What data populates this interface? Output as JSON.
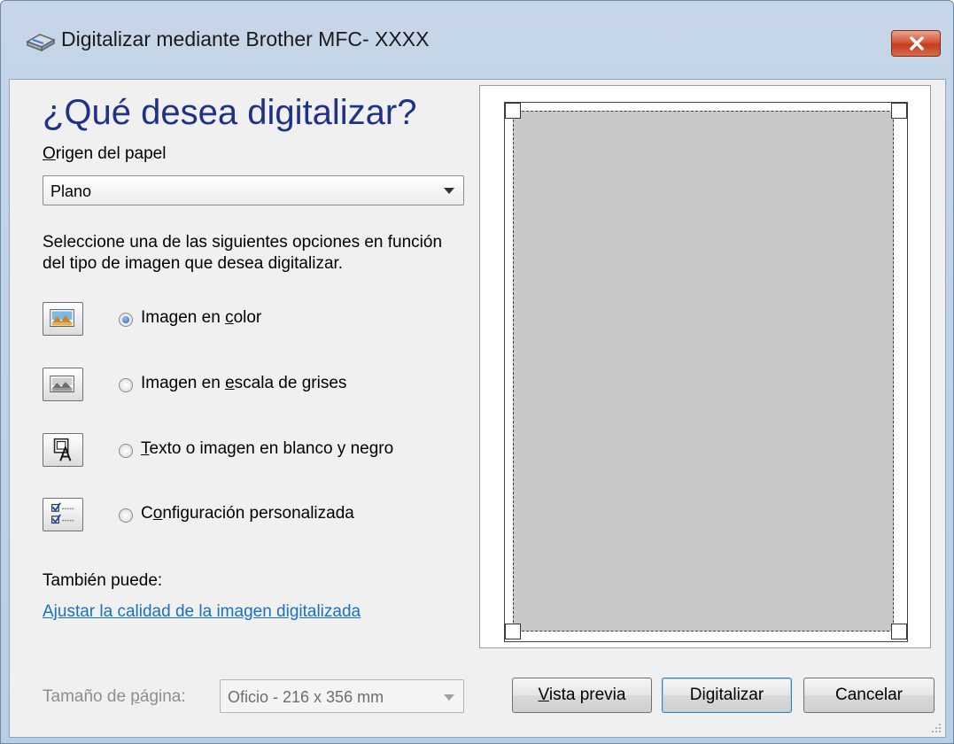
{
  "window": {
    "title": "Digitalizar mediante Brother MFC- XXXX"
  },
  "dialog": {
    "heading": "¿Qué desea digitalizar?",
    "paper_source": {
      "label_underlined": "O",
      "label_rest": "rigen del papel",
      "selected": "Plano"
    },
    "description": "Seleccione una de las siguientes opciones en función del tipo de imagen que desea digitalizar.",
    "options": [
      {
        "pre": "Imagen en ",
        "u": "c",
        "post": "olor",
        "checked": true
      },
      {
        "pre": "Imagen en ",
        "u": "e",
        "post": "scala de grises",
        "checked": false
      },
      {
        "pre": "",
        "u": "T",
        "post": "exto o imagen en blanco y negro",
        "checked": false
      },
      {
        "pre": "C",
        "u": "o",
        "post": "nfiguración personalizada",
        "checked": false
      }
    ],
    "also_label": "También puede:",
    "adjust_link": "Ajustar la calidad de la imagen digitalizada",
    "page_size": {
      "label_pre": "Tamaño de ",
      "label_u": "p",
      "label_post": "ágina:",
      "selected": "Oficio - 216 x 356 mm"
    },
    "buttons": {
      "preview_u": "V",
      "preview_rest": "ista previa",
      "scan": "Digitalizar",
      "cancel": "Cancelar"
    }
  },
  "colors": {
    "heading": "#1e3287",
    "link": "#1a6fc2",
    "preview_page": "#c8c8c8"
  }
}
